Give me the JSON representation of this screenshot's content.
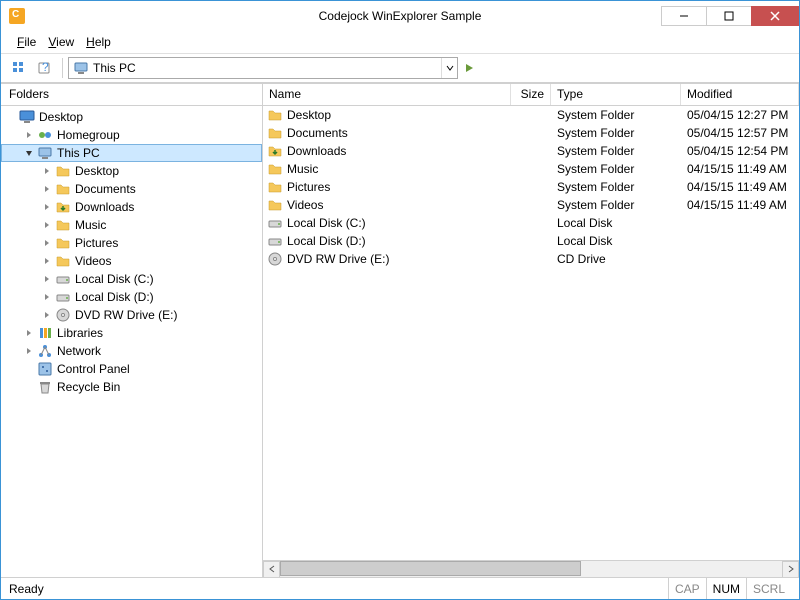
{
  "window": {
    "title": "Codejock WinExplorer Sample"
  },
  "menu": {
    "file": "File",
    "view": "View",
    "help": "Help"
  },
  "toolbar": {
    "address_label": "This PC"
  },
  "left": {
    "header": "Folders",
    "tree": [
      {
        "label": "Desktop",
        "depth": 0,
        "icon": "monitor",
        "exp": "none"
      },
      {
        "label": "Homegroup",
        "depth": 1,
        "icon": "homegroup",
        "exp": "closed"
      },
      {
        "label": "This PC",
        "depth": 1,
        "icon": "computer",
        "exp": "open",
        "selected": true
      },
      {
        "label": "Desktop",
        "depth": 2,
        "icon": "folder",
        "exp": "closed"
      },
      {
        "label": "Documents",
        "depth": 2,
        "icon": "folder",
        "exp": "closed"
      },
      {
        "label": "Downloads",
        "depth": 2,
        "icon": "folder-dl",
        "exp": "closed"
      },
      {
        "label": "Music",
        "depth": 2,
        "icon": "folder",
        "exp": "closed"
      },
      {
        "label": "Pictures",
        "depth": 2,
        "icon": "folder",
        "exp": "closed"
      },
      {
        "label": "Videos",
        "depth": 2,
        "icon": "folder",
        "exp": "closed"
      },
      {
        "label": "Local Disk (C:)",
        "depth": 2,
        "icon": "drive",
        "exp": "closed"
      },
      {
        "label": "Local Disk (D:)",
        "depth": 2,
        "icon": "drive",
        "exp": "closed"
      },
      {
        "label": "DVD RW Drive (E:)",
        "depth": 2,
        "icon": "cd",
        "exp": "closed"
      },
      {
        "label": "Libraries",
        "depth": 1,
        "icon": "libraries",
        "exp": "closed"
      },
      {
        "label": "Network",
        "depth": 1,
        "icon": "network",
        "exp": "closed"
      },
      {
        "label": "Control Panel",
        "depth": 1,
        "icon": "control",
        "exp": "none"
      },
      {
        "label": "Recycle Bin",
        "depth": 1,
        "icon": "bin",
        "exp": "none"
      }
    ]
  },
  "right": {
    "columns": {
      "name": "Name",
      "size": "Size",
      "type": "Type",
      "modified": "Modified"
    },
    "rows": [
      {
        "name": "Desktop",
        "size": "",
        "type": "System Folder",
        "modified": "05/04/15 12:27 PM",
        "icon": "folder"
      },
      {
        "name": "Documents",
        "size": "",
        "type": "System Folder",
        "modified": "05/04/15 12:57 PM",
        "icon": "folder"
      },
      {
        "name": "Downloads",
        "size": "",
        "type": "System Folder",
        "modified": "05/04/15 12:54 PM",
        "icon": "folder-dl"
      },
      {
        "name": "Music",
        "size": "",
        "type": "System Folder",
        "modified": "04/15/15 11:49 AM",
        "icon": "folder"
      },
      {
        "name": "Pictures",
        "size": "",
        "type": "System Folder",
        "modified": "04/15/15 11:49 AM",
        "icon": "folder"
      },
      {
        "name": "Videos",
        "size": "",
        "type": "System Folder",
        "modified": "04/15/15 11:49 AM",
        "icon": "folder"
      },
      {
        "name": "Local Disk (C:)",
        "size": "",
        "type": "Local Disk",
        "modified": "",
        "icon": "drive"
      },
      {
        "name": "Local Disk (D:)",
        "size": "",
        "type": "Local Disk",
        "modified": "",
        "icon": "drive"
      },
      {
        "name": "DVD RW Drive (E:)",
        "size": "",
        "type": "CD Drive",
        "modified": "",
        "icon": "cd"
      }
    ]
  },
  "status": {
    "ready": "Ready",
    "cap": "CAP",
    "num": "NUM",
    "scrl": "SCRL"
  }
}
